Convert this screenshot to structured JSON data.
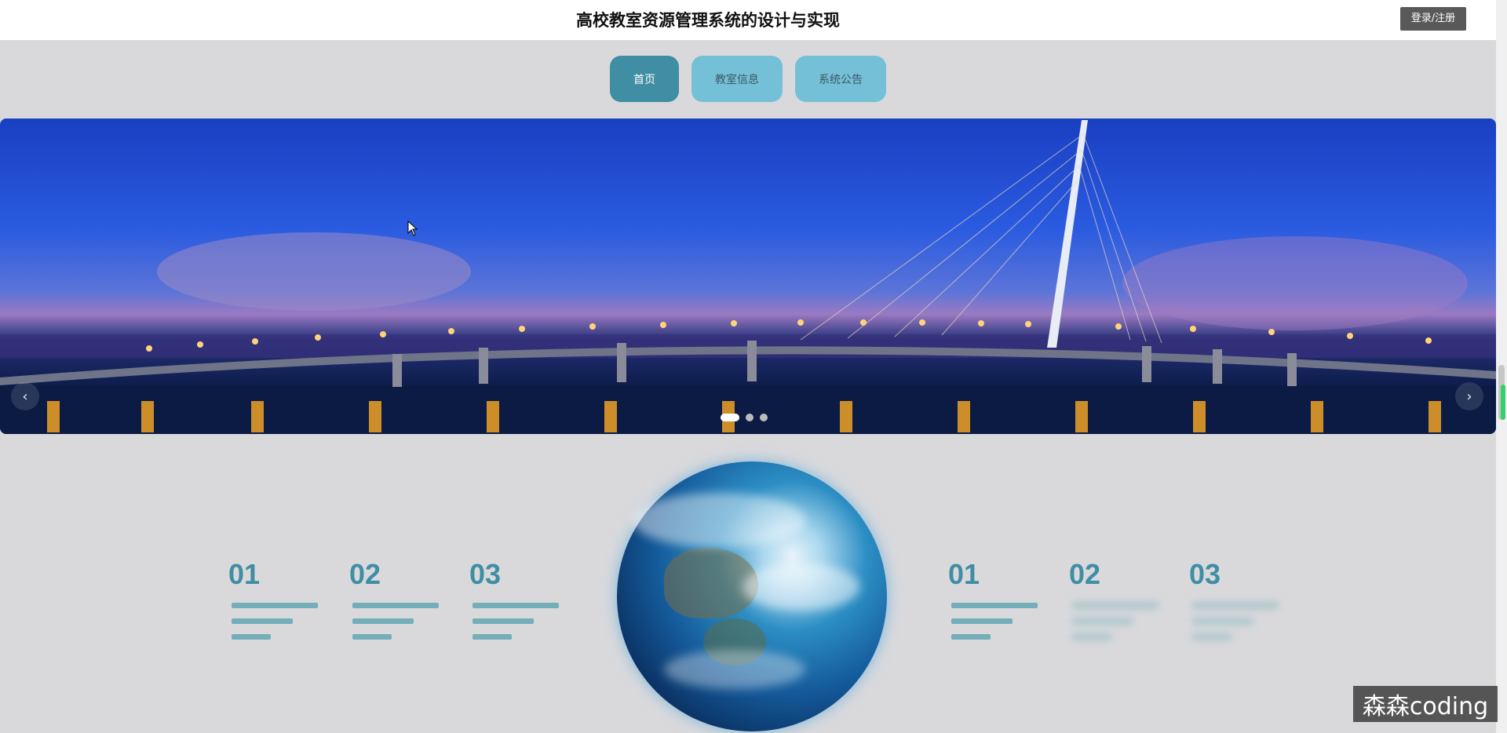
{
  "header": {
    "title": "高校教室资源管理系统的设计与实现",
    "login_label": "登录/注册"
  },
  "nav": {
    "items": [
      {
        "label": "首页",
        "active": true
      },
      {
        "label": "教室信息",
        "active": false
      },
      {
        "label": "系统公告",
        "active": false
      }
    ]
  },
  "carousel": {
    "prev_icon": "chevron-left-icon",
    "next_icon": "chevron-right-icon",
    "prev_glyph": "‹",
    "next_glyph": "›",
    "slide_count": 3,
    "active_slide": 1
  },
  "features": {
    "left": [
      "01",
      "02",
      "03"
    ],
    "right": [
      "01",
      "02",
      "03"
    ]
  },
  "watermark": "森森coding",
  "colors": {
    "accent": "#3f8ea3",
    "nav_inactive": "#74c0d6",
    "login_bg": "#595959"
  }
}
